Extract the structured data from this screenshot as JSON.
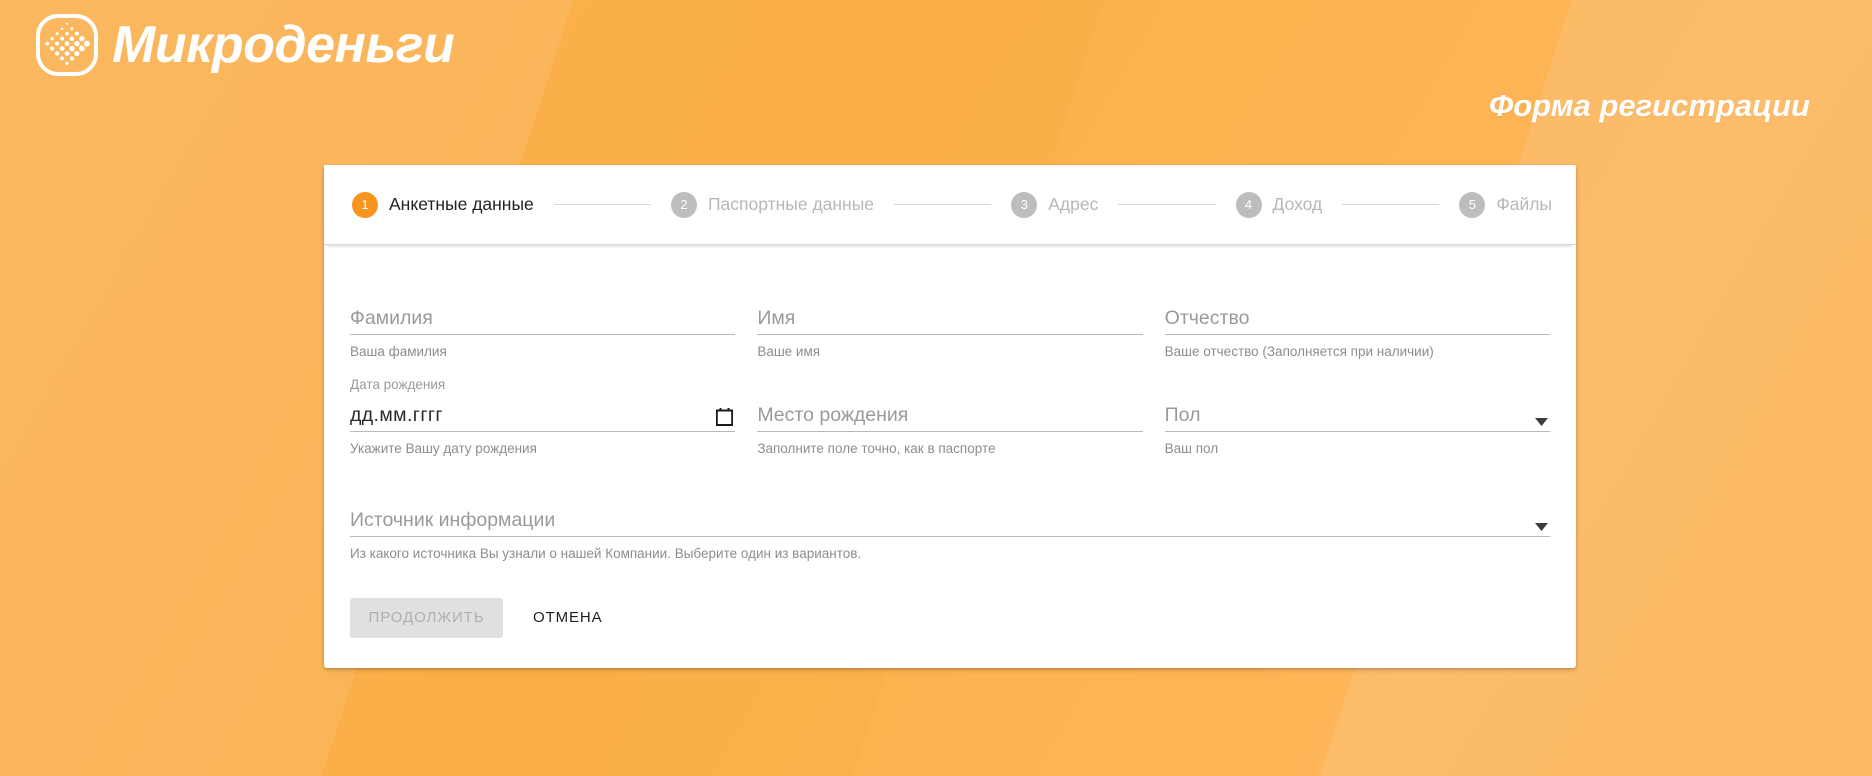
{
  "brand": {
    "logo_text": "Микроденьги",
    "logo_icon": "diamond-dots-squircle-icon"
  },
  "header": {
    "page_title": "Форма регистрации"
  },
  "colors": {
    "accent": "#F79520",
    "background": "#FBB042",
    "card": "#FFFFFF",
    "inactive_step": "#BDBDBD",
    "hint_text": "#8D8D8D",
    "placeholder_text": "#9A9A9A",
    "disabled_button_bg": "#E0E0E0",
    "disabled_button_text": "#B0B0B0"
  },
  "stepper": {
    "steps": [
      {
        "number": "1",
        "label": "Анкетные данные",
        "active": true
      },
      {
        "number": "2",
        "label": "Паспортные данные",
        "active": false
      },
      {
        "number": "3",
        "label": "Адрес",
        "active": false
      },
      {
        "number": "4",
        "label": "Доход",
        "active": false
      },
      {
        "number": "5",
        "label": "Файлы",
        "active": false
      }
    ]
  },
  "form": {
    "row1": {
      "last_name": {
        "placeholder": "Фамилия",
        "value": "",
        "hint": "Ваша фамилия"
      },
      "first_name": {
        "placeholder": "Имя",
        "value": "",
        "hint": "Ваше имя"
      },
      "middle_name": {
        "placeholder": "Отчество",
        "value": "",
        "hint": "Ваше отчество (Заполняется при наличии)"
      }
    },
    "row2": {
      "birth_date": {
        "label": "Дата рождения",
        "value": "дд.мм.гггг",
        "hint": "Укажите Вашу дату рождения",
        "icon": "calendar-icon"
      },
      "birth_place": {
        "placeholder": "Место рождения",
        "value": "",
        "hint": "Заполните поле точно, как в паспорте"
      },
      "gender": {
        "placeholder": "Пол",
        "value": "",
        "hint": "Ваш пол",
        "icon": "chevron-down-icon"
      }
    },
    "row3": {
      "info_source": {
        "placeholder": "Источник информации",
        "value": "",
        "hint": "Из какого источника Вы узнали о нашей Компании. Выберите один из вариантов.",
        "icon": "chevron-down-icon"
      }
    },
    "actions": {
      "submit_label": "ПРОДОЛЖИТЬ",
      "submit_disabled": true,
      "cancel_label": "ОТМЕНА"
    }
  }
}
